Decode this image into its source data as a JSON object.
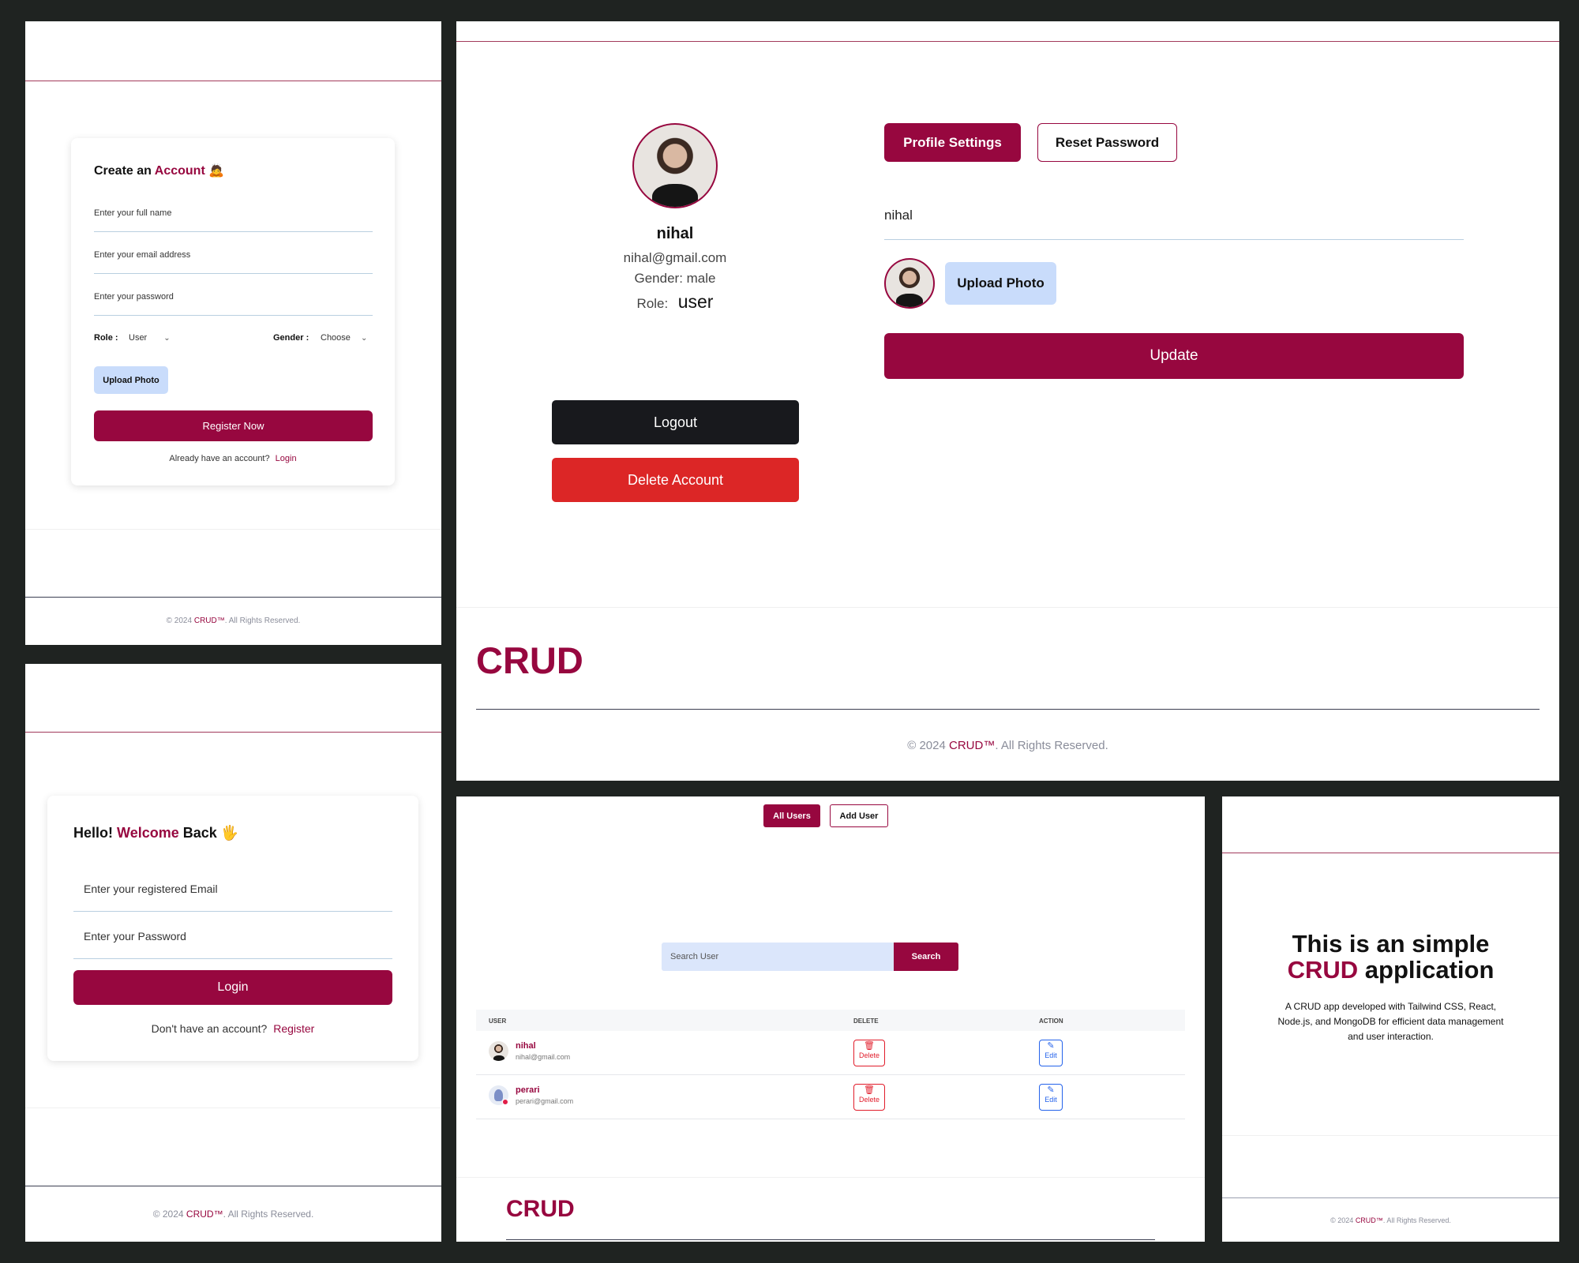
{
  "register": {
    "title_prefix": "Create an",
    "title_accent": "Account",
    "title_emoji": "🙇",
    "fullname_placeholder": "Enter your full name",
    "email_placeholder": "Enter your email address",
    "password_placeholder": "Enter your password",
    "role_label": "Role :",
    "role_value": "User",
    "gender_label": "Gender :",
    "gender_value": "Choose",
    "upload_label": "Upload Photo",
    "submit_label": "Register Now",
    "login_prompt": "Already have an account?",
    "login_link": "Login",
    "footer_prefix": "© 2024",
    "footer_brand": "CRUD™",
    "footer_suffix": ". All Rights Reserved."
  },
  "profile": {
    "name": "nihal",
    "email": "nihal@gmail.com",
    "gender_line": "Gender: male",
    "role_label": "Role:",
    "role_value": "user",
    "logout_label": "Logout",
    "delete_label": "Delete Account",
    "tab_profile": "Profile Settings",
    "tab_reset": "Reset Password",
    "name_value": "nihal",
    "upload_label": "Upload Photo",
    "update_label": "Update",
    "brand": "CRUD",
    "footer_prefix": "© 2024",
    "footer_brand": "CRUD™",
    "footer_suffix": ". All Rights Reserved."
  },
  "login": {
    "title_prefix": "Hello!",
    "title_accent": "Welcome",
    "title_suffix": "Back",
    "title_emoji": "🖐",
    "email_placeholder": "Enter your registered Email",
    "password_placeholder": "Enter your Password",
    "submit_label": "Login",
    "register_prompt": "Don't have an account?",
    "register_link": "Register",
    "footer_prefix": "© 2024",
    "footer_brand": "CRUD™",
    "footer_suffix": ". All Rights Reserved."
  },
  "users": {
    "tab_all": "All Users",
    "tab_add": "Add User",
    "search_placeholder": "Search User",
    "search_button": "Search",
    "col_user": "USER",
    "col_delete": "DELETE",
    "col_action": "ACTION",
    "rows": [
      {
        "name": "nihal",
        "email": "nihal@gmail.com",
        "delete": "Delete",
        "edit": "Edit"
      },
      {
        "name": "perari",
        "email": "perari@gmail.com",
        "delete": "Delete",
        "edit": "Edit"
      }
    ],
    "brand": "CRUD"
  },
  "about": {
    "line1": "This is an simple",
    "accent": "CRUD",
    "line2_suffix": "application",
    "description": "A CRUD app developed with Tailwind CSS, React, Node.js, and MongoDB for efficient data management and user interaction.",
    "footer_prefix": "© 2024",
    "footer_brand": "CRUD™",
    "footer_suffix": ". All Rights Reserved."
  }
}
